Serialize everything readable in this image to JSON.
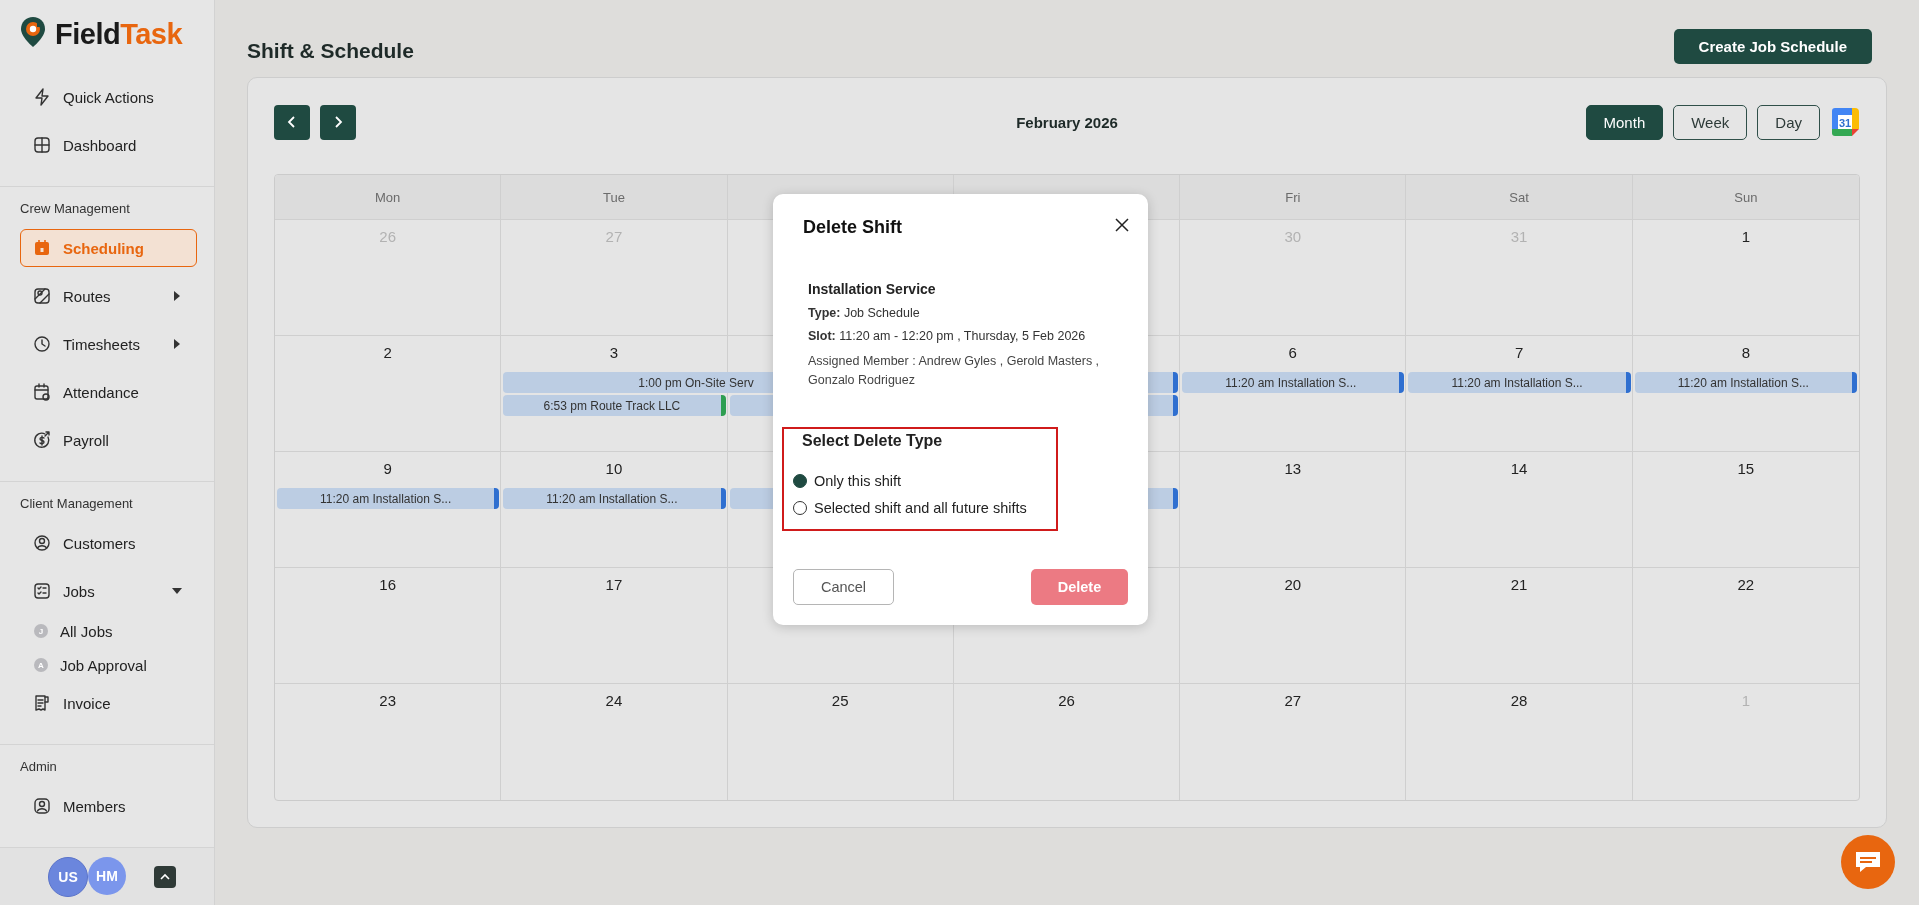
{
  "brand": {
    "name_dark": "Field",
    "name_accent": "Task"
  },
  "sidebar": {
    "sections": [
      {
        "items": [
          {
            "label": "Quick Actions",
            "selected": false
          },
          {
            "label": "Dashboard",
            "selected": false
          }
        ]
      },
      {
        "heading": "Crew Management",
        "items": [
          {
            "label": "Scheduling",
            "selected": true
          },
          {
            "label": "Routes",
            "selected": false,
            "expanded": false
          },
          {
            "label": "Timesheets",
            "selected": false,
            "expanded": false
          },
          {
            "label": "Attendance",
            "selected": false
          },
          {
            "label": "Payroll",
            "selected": false
          }
        ]
      },
      {
        "heading": "Client Management",
        "items": [
          {
            "label": "Customers",
            "selected": false
          },
          {
            "label": "Jobs",
            "selected": false,
            "expanded": true,
            "children": [
              {
                "label": "All Jobs",
                "badge": "J",
                "selected": false
              },
              {
                "label": "Job Approval",
                "badge": "A",
                "selected": false
              }
            ]
          },
          {
            "label": "Invoice",
            "selected": false
          }
        ]
      },
      {
        "heading": "Admin",
        "items": [
          {
            "label": "Members",
            "selected": false
          }
        ]
      }
    ],
    "avatars": [
      "US",
      "HM"
    ]
  },
  "page": {
    "title": "Shift & Schedule",
    "create_button": "Create Job Schedule"
  },
  "calendar": {
    "month_label": "February 2026",
    "views": [
      {
        "label": "Month",
        "selected": true
      },
      {
        "label": "Week",
        "selected": false
      },
      {
        "label": "Day",
        "selected": false
      }
    ],
    "gcal_day": "31",
    "weekdays": {
      "left": [
        {
          "label": "Mon"
        },
        {
          "label": "Tue"
        }
      ],
      "right": [
        {
          "label": "Fri"
        },
        {
          "label": "Sat"
        },
        {
          "label": "Sun"
        }
      ]
    },
    "weeks": [
      {
        "left": [
          {
            "date": "26",
            "muted": true
          },
          {
            "date": "27",
            "muted": true
          }
        ],
        "right": [
          {
            "date": "30",
            "muted": true
          },
          {
            "date": "31",
            "muted": true
          },
          {
            "date": "1",
            "muted": false
          }
        ]
      },
      {
        "left": [
          {
            "date": "2",
            "muted": false
          },
          {
            "date": "3",
            "muted": false,
            "events": [
              {
                "kind": "multi_day",
                "text": "1:00 pm On-Site Serv",
                "color": "#2f6fd0"
              },
              {
                "kind": "single",
                "text": "6:53 pm Route Track LLC",
                "color": "#2e9e50"
              }
            ]
          }
        ],
        "middle": [
          {
            "events": [
              {
                "kind": "single"
              }
            ]
          },
          {
            "events": [
              {
                "kind": "single",
                "color": "#2f6fd0"
              }
            ]
          }
        ],
        "right": [
          {
            "date": "6",
            "muted": false,
            "events": [
              {
                "kind": "single",
                "text": "11:20 am Installation S...",
                "color": "#2f6fd0"
              }
            ]
          },
          {
            "date": "7",
            "muted": false,
            "events": [
              {
                "kind": "single",
                "text": "11:20 am Installation S...",
                "color": "#2f6fd0"
              }
            ]
          },
          {
            "date": "8",
            "muted": false,
            "events": [
              {
                "kind": "single",
                "text": "11:20 am Installation S...",
                "color": "#2f6fd0"
              }
            ]
          }
        ]
      },
      {
        "left": [
          {
            "date": "9",
            "muted": false,
            "events": [
              {
                "kind": "single",
                "text": "11:20 am Installation S...",
                "color": "#2f6fd0"
              }
            ]
          },
          {
            "date": "10",
            "muted": false,
            "events": [
              {
                "kind": "single",
                "text": "11:20 am Installation S...",
                "color": "#2f6fd0"
              }
            ]
          }
        ],
        "middle": [
          {
            "events": [
              {
                "kind": "single"
              }
            ]
          },
          {
            "events": [
              {
                "kind": "single",
                "color": "#2f6fd0"
              }
            ]
          }
        ],
        "right": [
          {
            "date": "13",
            "muted": false
          },
          {
            "date": "14",
            "muted": false
          },
          {
            "date": "15",
            "muted": false
          }
        ]
      },
      {
        "left": [
          {
            "date": "16",
            "muted": false
          },
          {
            "date": "17",
            "muted": false
          }
        ],
        "right": [
          {
            "date": "20",
            "muted": false
          },
          {
            "date": "21",
            "muted": false
          },
          {
            "date": "22",
            "muted": false
          }
        ]
      },
      {
        "left": [
          {
            "date": "23",
            "muted": false
          },
          {
            "date": "24",
            "muted": false
          }
        ],
        "middle": [
          {
            "date": "25",
            "muted": false
          },
          {
            "date": "26",
            "muted": false
          }
        ],
        "right": [
          {
            "date": "27",
            "muted": false
          },
          {
            "date": "28",
            "muted": false
          },
          {
            "date": "1",
            "muted": true
          }
        ]
      }
    ]
  },
  "dialog": {
    "title": "Delete Shift",
    "service": "Installation Service",
    "type_line": "**Type:** Job Schedule",
    "slot_line": "**Slot:** 11:20 am - 12:20 pm , Thursday, 5 Feb 2026",
    "assigned": "Assigned Member : Andrew Gyles , Gerold Masters , Gonzalo Rodriguez",
    "delete_type": {
      "heading": "Select Delete Type",
      "options": [
        {
          "label": "Only this shift",
          "selected": true
        },
        {
          "label": "Selected shift and all future shifts",
          "selected": false
        }
      ]
    },
    "cancel_button": "Cancel",
    "delete_button": "Delete"
  }
}
